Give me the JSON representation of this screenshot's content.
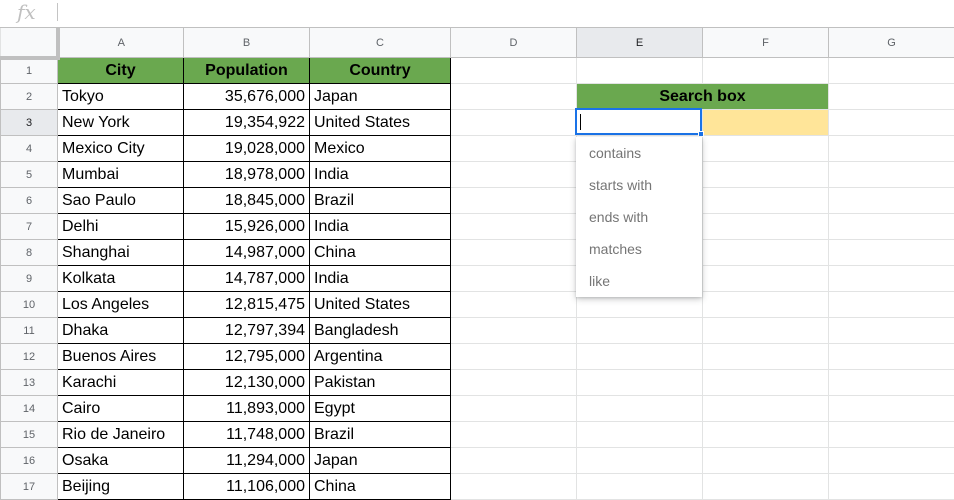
{
  "formula_bar": {
    "fx_label": "fx"
  },
  "columns": [
    "A",
    "B",
    "C",
    "D",
    "E",
    "F",
    "G"
  ],
  "rows": [
    "1",
    "2",
    "3",
    "4",
    "5",
    "6",
    "7",
    "8",
    "9",
    "10",
    "11",
    "12",
    "13",
    "14",
    "15",
    "16",
    "17"
  ],
  "table": {
    "headers": [
      "City",
      "Population",
      "Country"
    ],
    "data": [
      [
        "Tokyo",
        "35,676,000",
        "Japan"
      ],
      [
        "New York",
        "19,354,922",
        "United States"
      ],
      [
        "Mexico City",
        "19,028,000",
        "Mexico"
      ],
      [
        "Mumbai",
        "18,978,000",
        "India"
      ],
      [
        "Sao Paulo",
        "18,845,000",
        "Brazil"
      ],
      [
        "Delhi",
        "15,926,000",
        "India"
      ],
      [
        "Shanghai",
        "14,987,000",
        "China"
      ],
      [
        "Kolkata",
        "14,787,000",
        "India"
      ],
      [
        "Los Angeles",
        "12,815,475",
        "United States"
      ],
      [
        "Dhaka",
        "12,797,394",
        "Bangladesh"
      ],
      [
        "Buenos Aires",
        "12,795,000",
        "Argentina"
      ],
      [
        "Karachi",
        "12,130,000",
        "Pakistan"
      ],
      [
        "Cairo",
        "11,893,000",
        "Egypt"
      ],
      [
        "Rio de Janeiro",
        "11,748,000",
        "Brazil"
      ],
      [
        "Osaka",
        "11,294,000",
        "Japan"
      ],
      [
        "Beijing",
        "11,106,000",
        "China"
      ]
    ]
  },
  "search_box": {
    "title": "Search box",
    "value": ""
  },
  "dropdown": {
    "options": [
      "contains",
      "starts with",
      "ends with",
      "matches",
      "like"
    ]
  },
  "colors": {
    "header_green": "#6aa84f",
    "search_yellow": "#ffe599",
    "selection_blue": "#1a73e8"
  }
}
